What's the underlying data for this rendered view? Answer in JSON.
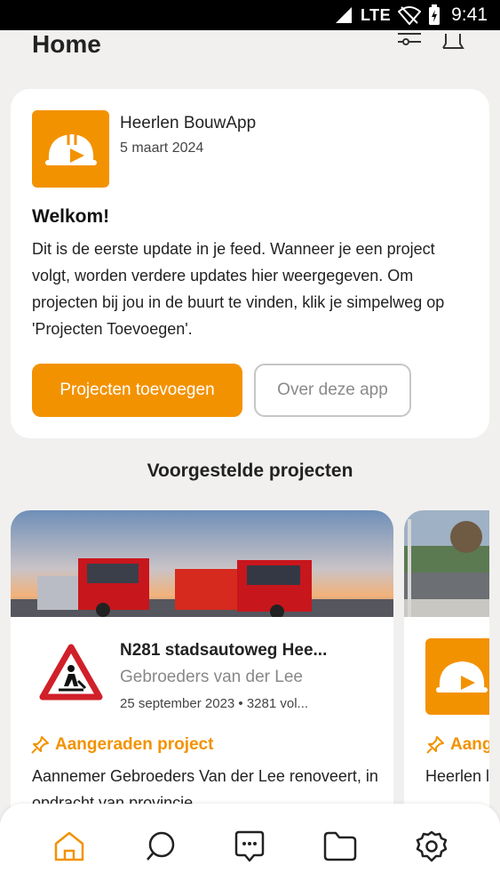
{
  "status_bar": {
    "network": "LTE",
    "time": "9:41"
  },
  "header": {
    "title": "Home",
    "icons": [
      "filter-icon",
      "bell-icon"
    ]
  },
  "feed_post": {
    "app_name": "Heerlen BouwApp",
    "date": "5 maart 2024",
    "title": "Welkom!",
    "body": "Dit is de eerste update in je feed. Wanneer je een project volgt, worden verdere updates hier weergegeven. Om projecten bij jou in de buurt te vinden, klik je simpelweg op 'Projecten Toevoegen'.",
    "primary_button": "Projecten toevoegen",
    "secondary_button": "Over deze app",
    "accent_color": "#f39200"
  },
  "suggested": {
    "section_title": "Voorgestelde projecten",
    "projects": [
      {
        "title": "N281 stadsautoweg Hee...",
        "company": "Gebroeders van der Lee",
        "meta": "25 september 2023 • 3281 vol...",
        "badge": "Aangeraden project",
        "description": "Aannemer Gebroeders Van der Lee renoveert, in opdracht van provincie",
        "icon": "road-works-sign-icon"
      },
      {
        "badge": "Aang",
        "description": "Heerlen levendig",
        "icon": "helmet-logo-icon"
      }
    ]
  },
  "bottom_nav": {
    "items": [
      "home-icon",
      "search-icon",
      "chat-icon",
      "folder-icon",
      "settings-icon"
    ],
    "active": "home-icon"
  }
}
